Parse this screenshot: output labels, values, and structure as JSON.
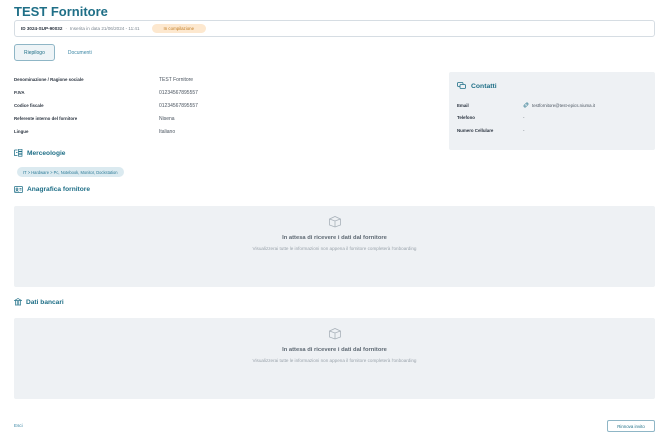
{
  "page": {
    "title": "TEST Fornitore"
  },
  "header": {
    "id": "ID 3024-SUP-90032",
    "inserted": "Inserita in data 21/06/2024 - 11:41",
    "status": "In compilazione"
  },
  "tabs": [
    {
      "label": "Riepilogo",
      "active": true
    },
    {
      "label": "Documenti",
      "active": false
    }
  ],
  "info": [
    {
      "label": "Denominazione / Ragione sociale",
      "value": "TEST Fornitore"
    },
    {
      "label": "P.IVA",
      "value": "01234567895557"
    },
    {
      "label": "Codice fiscale",
      "value": "01234567895557"
    },
    {
      "label": "Referente interno del fornitore",
      "value": "Nisena"
    },
    {
      "label": "Lingue",
      "value": "Italiano"
    }
  ],
  "contacts": {
    "title": "Contatti",
    "rows": [
      {
        "label": "Email",
        "value": "testfornitore@test-epics.niuma.it"
      },
      {
        "label": "Telefono",
        "value": "-"
      },
      {
        "label": "Numero Cellulare",
        "value": "-"
      }
    ]
  },
  "merceologie": {
    "title": "Merceologie",
    "chip": "IT > Hardware > Pc, Notebook, Monitor, Dockstation"
  },
  "anagrafica": {
    "title": "Anagrafica fornitore",
    "empty_title": "In attesa di ricevere i dati dal fornitore",
    "empty_sub": "Visualizzerai tutte le informazioni non appena il fornitore completerà l'onboarding"
  },
  "bancari": {
    "title": "Dati bancari",
    "empty_title": "In attesa di ricevere i dati dal fornitore",
    "empty_sub": "Visualizzerai tutte le informazioni non appena il fornitore completerà l'onboarding"
  },
  "footer": {
    "left": "Esci",
    "button": "Rinnova invito"
  },
  "colors": {
    "accent": "#1f6f87",
    "badge_bg": "#fde8cf",
    "panel": "#eef1f4"
  }
}
